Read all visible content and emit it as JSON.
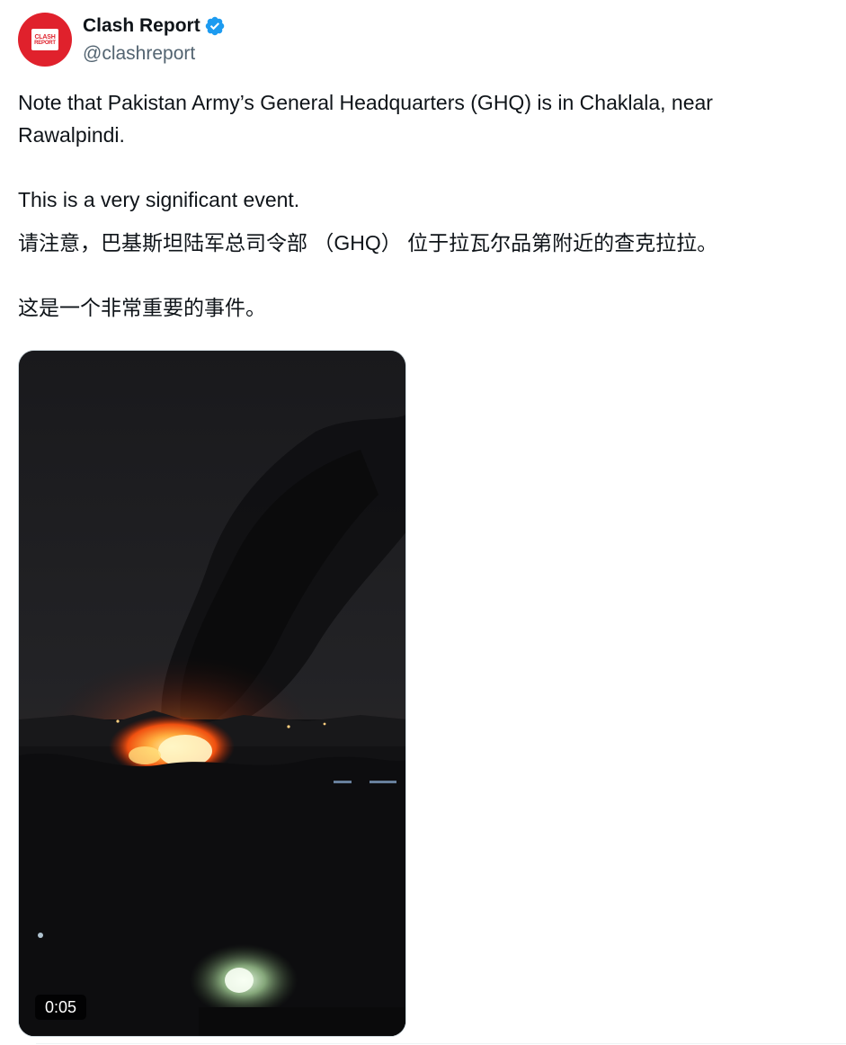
{
  "author": {
    "display_name": "Clash Report",
    "handle": "@clashreport",
    "verified": true,
    "avatar_logo_top": "CLASH",
    "avatar_logo_bottom": "REPORT",
    "avatar_color": "#e0212c",
    "verified_color": "#1d9bf0"
  },
  "tweet": {
    "paragraph_1": "Note that Pakistan Army’s General Headquarters (GHQ) is in Chaklala, near Rawalpindi.",
    "paragraph_2": "This is a very significant event.",
    "paragraph_3": "请注意，巴基斯坦陆军总司令部 （GHQ） 位于拉瓦尔品第附近的查克拉拉。",
    "paragraph_4": "这是一个非常重要的事件。"
  },
  "media": {
    "type": "video",
    "duration": "0:05",
    "description_icon": "video-thumbnail-night-fire"
  }
}
